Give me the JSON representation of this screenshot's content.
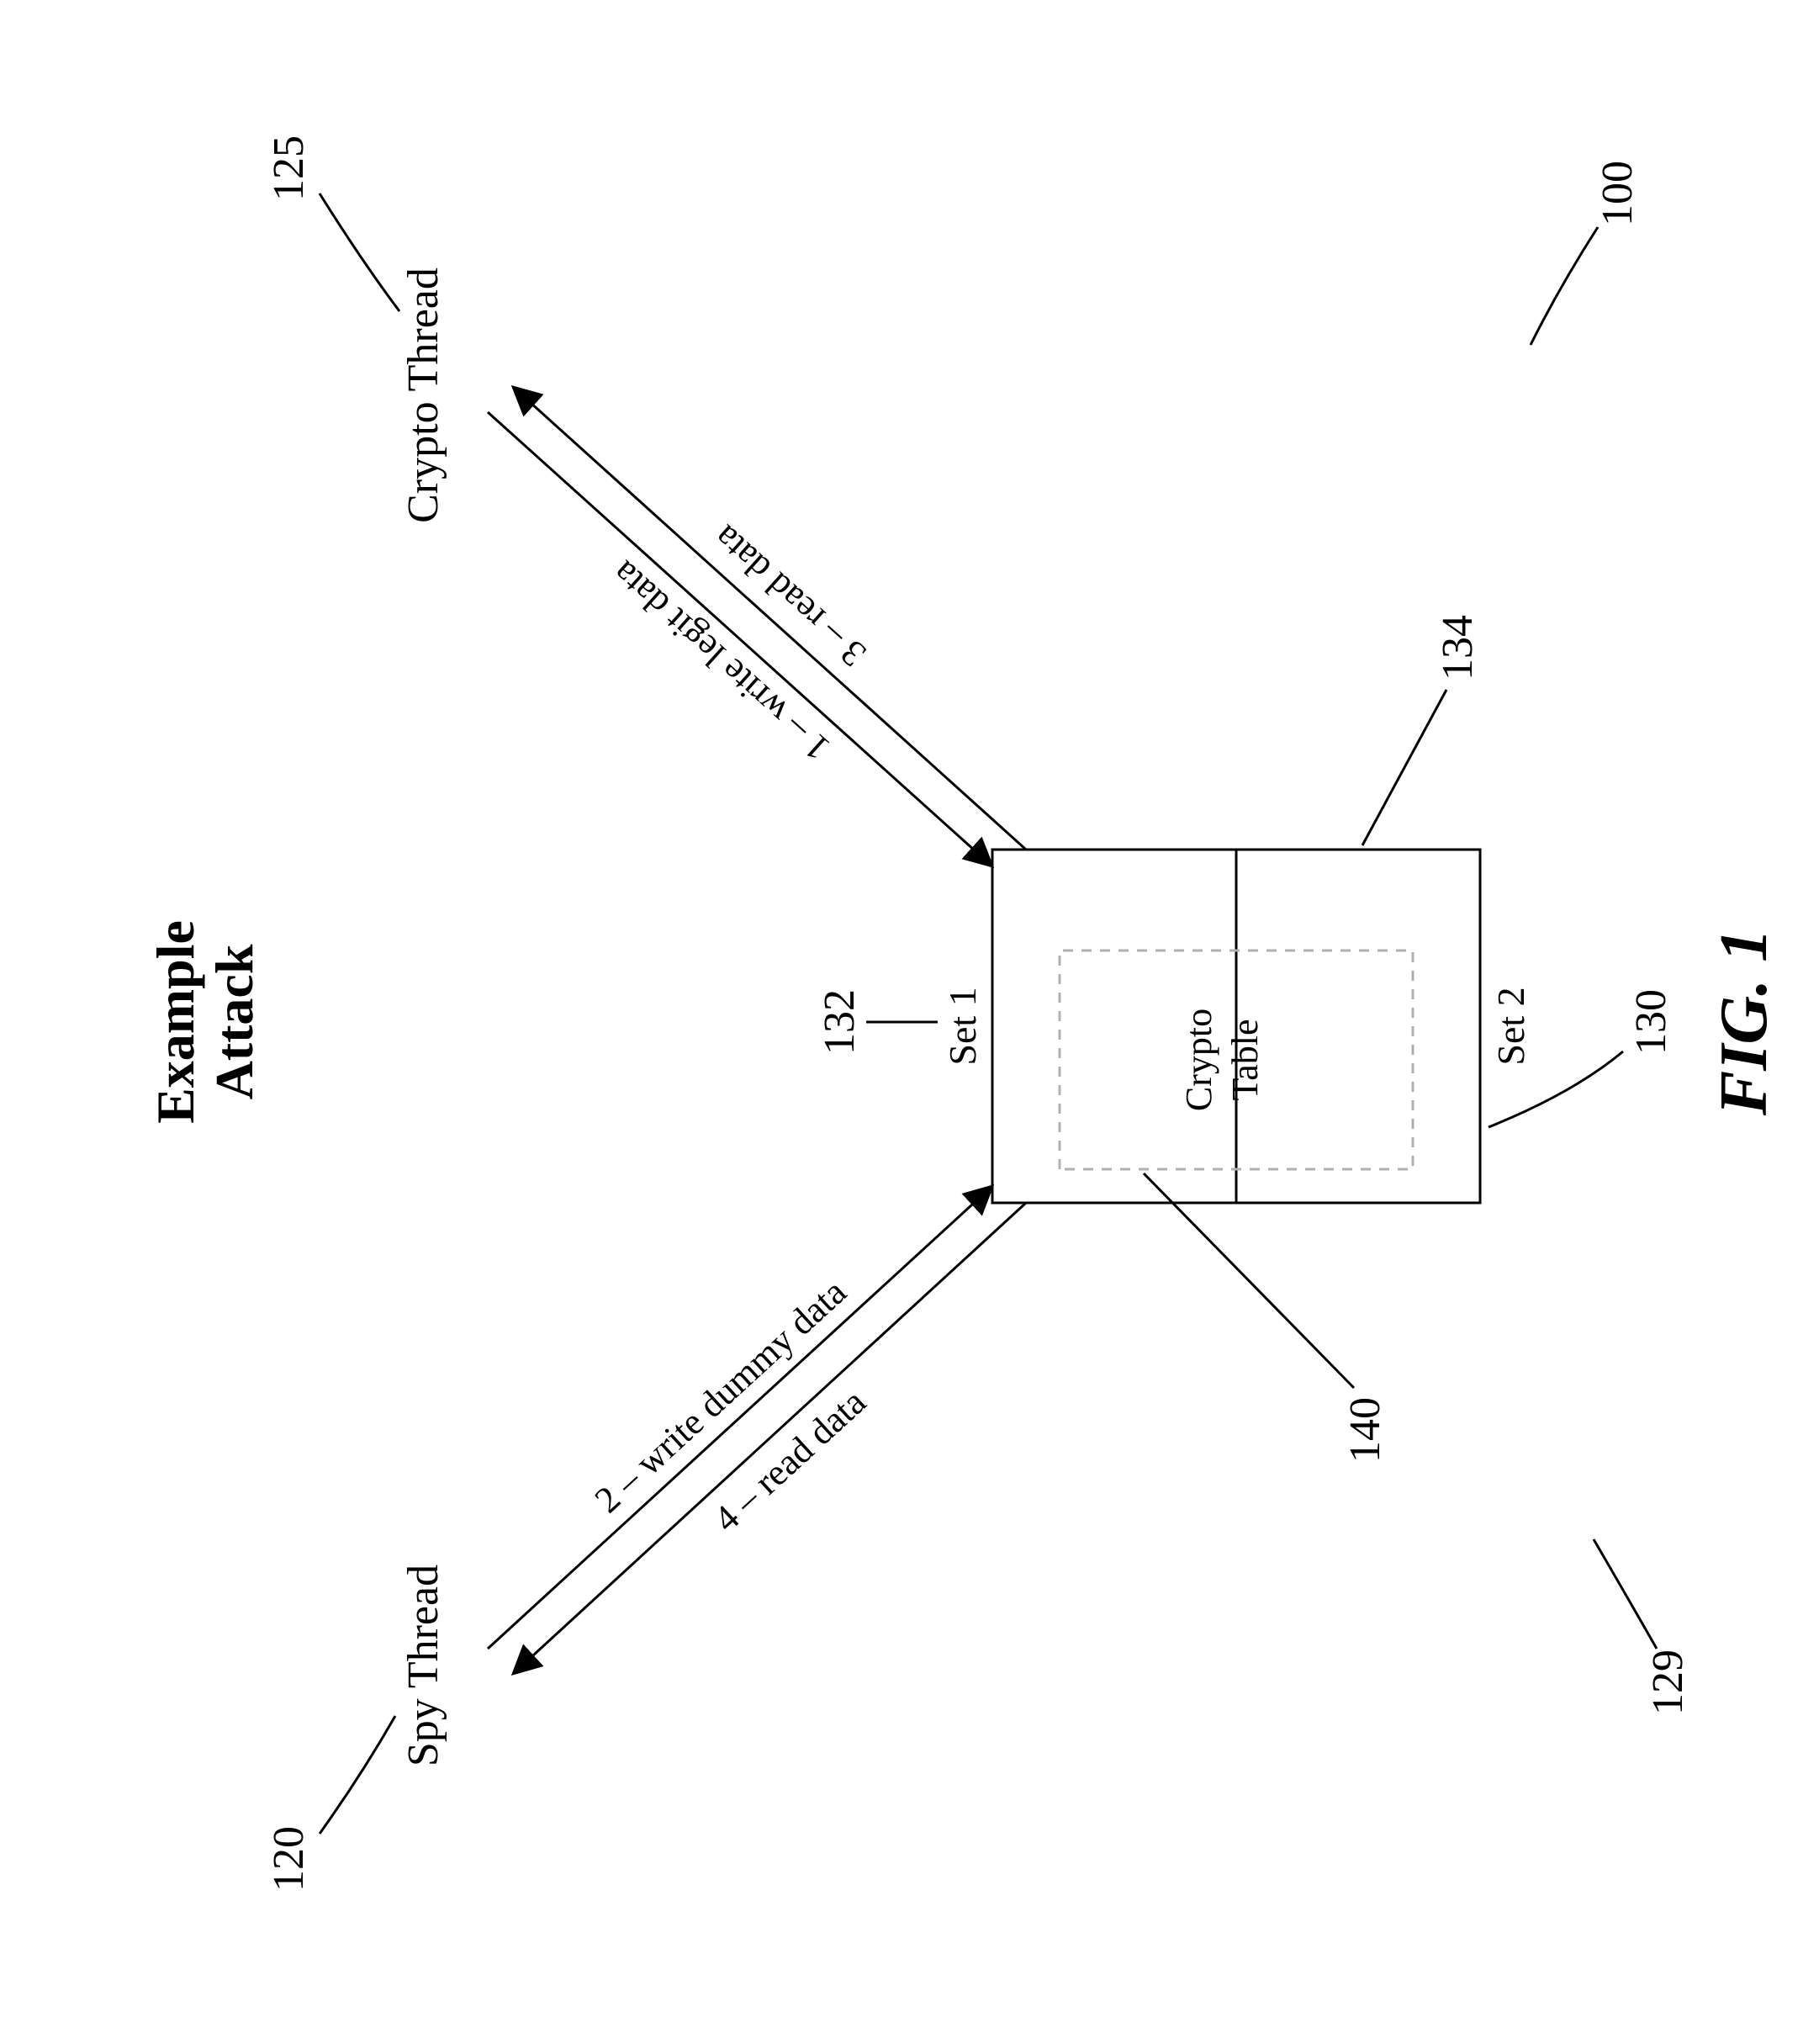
{
  "title_line1": "Example",
  "title_line2": "Attack",
  "spy_thread": "Spy Thread",
  "crypto_thread": "Crypto Thread",
  "arrow_spy_write": "2 – write dummy data",
  "arrow_spy_read": "4 – read data",
  "arrow_crypto_write": "1 – write legit data",
  "arrow_crypto_read": "3 – read data",
  "set1": "Set 1",
  "set2": "Set 2",
  "crypto_table": "Crypto Table",
  "ref_spy": "120",
  "ref_crypto": "125",
  "ref_set1": "132",
  "ref_set2": "134",
  "ref_cache": "130",
  "ref_frame": "129",
  "ref_system": "100",
  "ref_table": "140",
  "fig_label": "FIG. 1"
}
